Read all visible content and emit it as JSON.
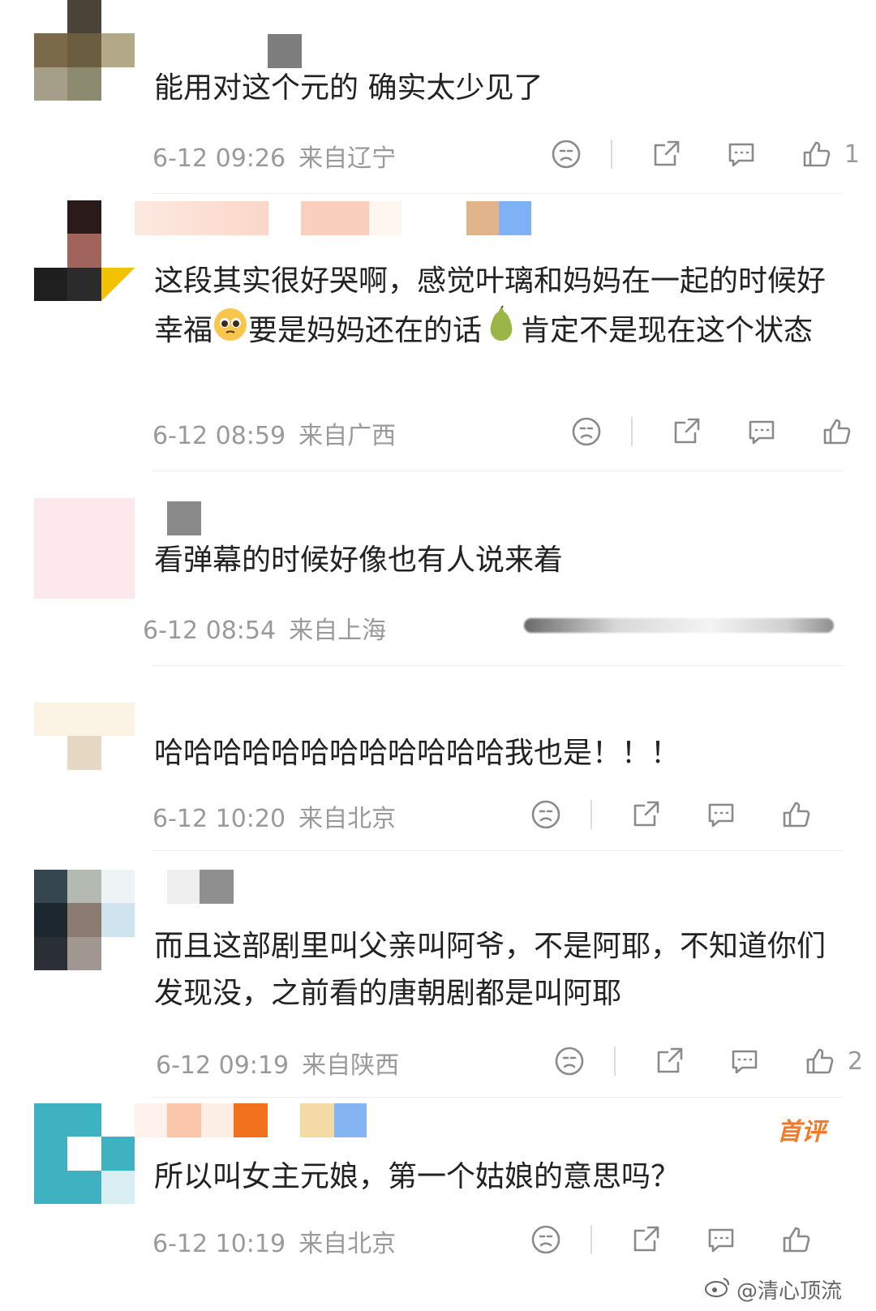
{
  "comments": [
    {
      "text": "能用对这个元的 确实太少见了",
      "date": "6-12 09:26",
      "location": "来自辽宁",
      "likes": "1"
    },
    {
      "text_parts": [
        "这段其实很好哭啊，感觉叶璃和妈妈在一起的时候好幸福",
        "要是妈妈还在的话",
        "肯定不是现在这个状态"
      ],
      "date": "6-12 08:59",
      "location": "来自广西",
      "likes": ""
    },
    {
      "text": "看弹幕的时候好像也有人说来着",
      "date": "6-12 08:54",
      "location": "来自上海"
    },
    {
      "text": "哈哈哈哈哈哈哈哈哈哈哈哈我也是！！！",
      "date": "6-12 10:20",
      "location": "来自北京",
      "likes": ""
    },
    {
      "text": "而且这部剧里叫父亲叫阿爷，不是阿耶，不知道你们发现没，之前看的唐朝剧都是叫阿耶",
      "date": "6-12 09:19",
      "location": "来自陕西",
      "likes": "2"
    },
    {
      "text": "所以叫女主元娘，第一个姑娘的意思吗？",
      "date": "6-12 10:19",
      "location": "来自北京",
      "likes": "",
      "badge": "首评"
    }
  ],
  "watermark": "@清心顶流",
  "icons": [
    "dislike-icon",
    "share-icon",
    "reply-icon",
    "like-icon"
  ],
  "colors": {
    "meta_gray": "#9a9a9a",
    "badge_orange": "#f37a2b"
  }
}
